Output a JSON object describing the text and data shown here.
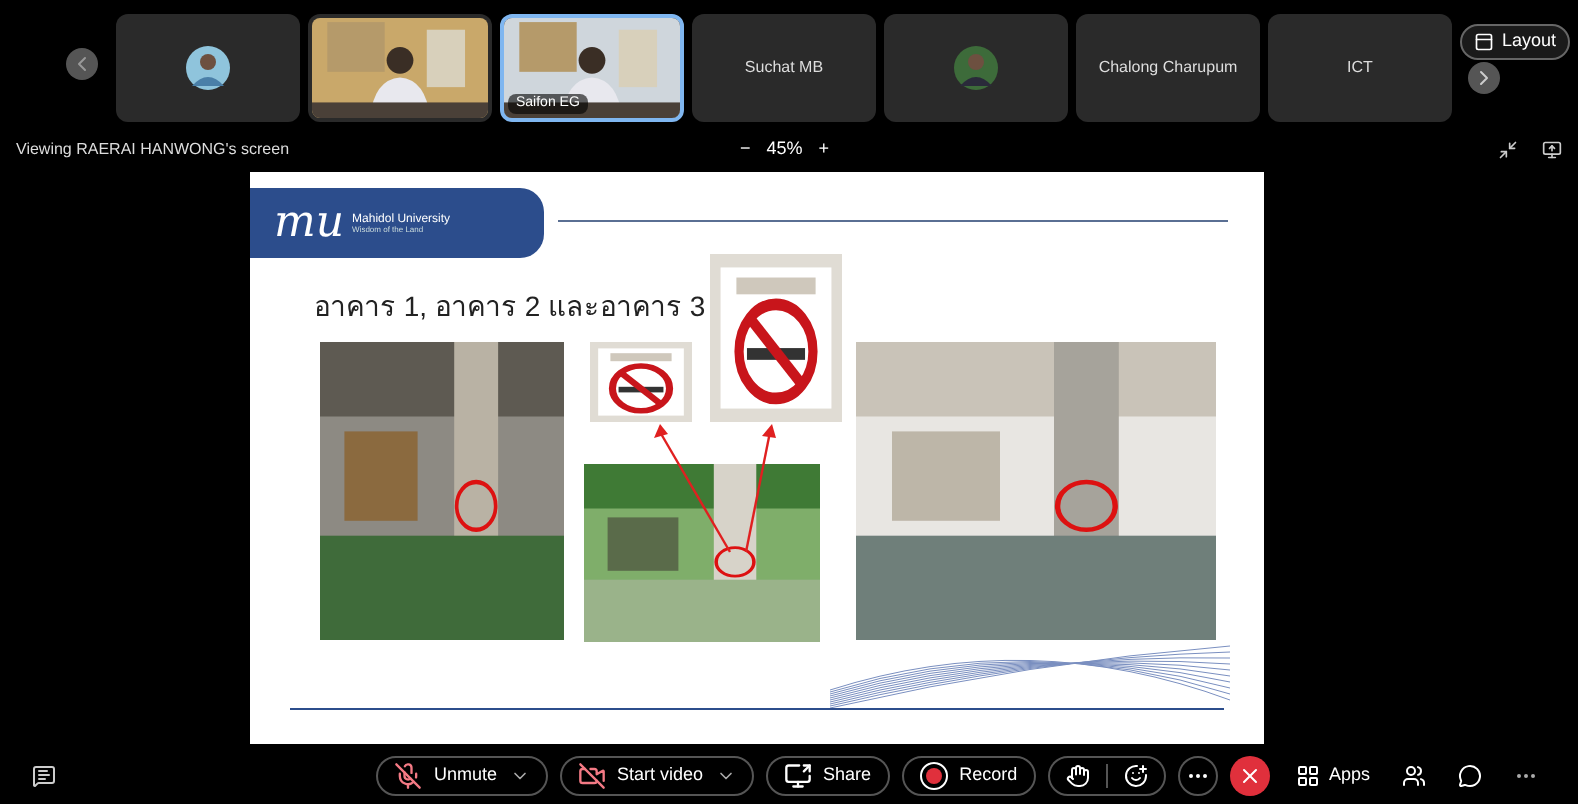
{
  "participants": [
    {
      "kind": "avatar",
      "selected": false
    },
    {
      "kind": "video",
      "selected": false
    },
    {
      "kind": "video",
      "name": "Saifon EG",
      "selected": true
    },
    {
      "kind": "name",
      "name": "Suchat MB",
      "selected": false
    },
    {
      "kind": "avatar",
      "selected": false
    },
    {
      "kind": "name",
      "name": "Chalong Charupum",
      "selected": false
    },
    {
      "kind": "name",
      "name": "ICT",
      "selected": false
    }
  ],
  "layout_button": "Layout",
  "viewing": "Viewing RAERAI HANWONG's screen",
  "zoom": {
    "minus": "−",
    "value": "45%",
    "plus": "+"
  },
  "slide": {
    "logo_mark": "mu",
    "logo_title": "Mahidol University",
    "logo_subtitle": "Wisdom of the Land",
    "title": "อาคาร 1, อาคาร 2 และอาคาร 3"
  },
  "controls": [
    {
      "kind": "mic",
      "label": "Unmute",
      "dropdown": true
    },
    {
      "kind": "video",
      "label": "Start video",
      "dropdown": true
    },
    {
      "kind": "share",
      "label": "Share",
      "dropdown": false
    },
    {
      "kind": "record",
      "label": "Record",
      "dropdown": false
    },
    {
      "kind": "reactions"
    },
    {
      "kind": "more"
    },
    {
      "kind": "leave"
    }
  ],
  "apps": "Apps"
}
